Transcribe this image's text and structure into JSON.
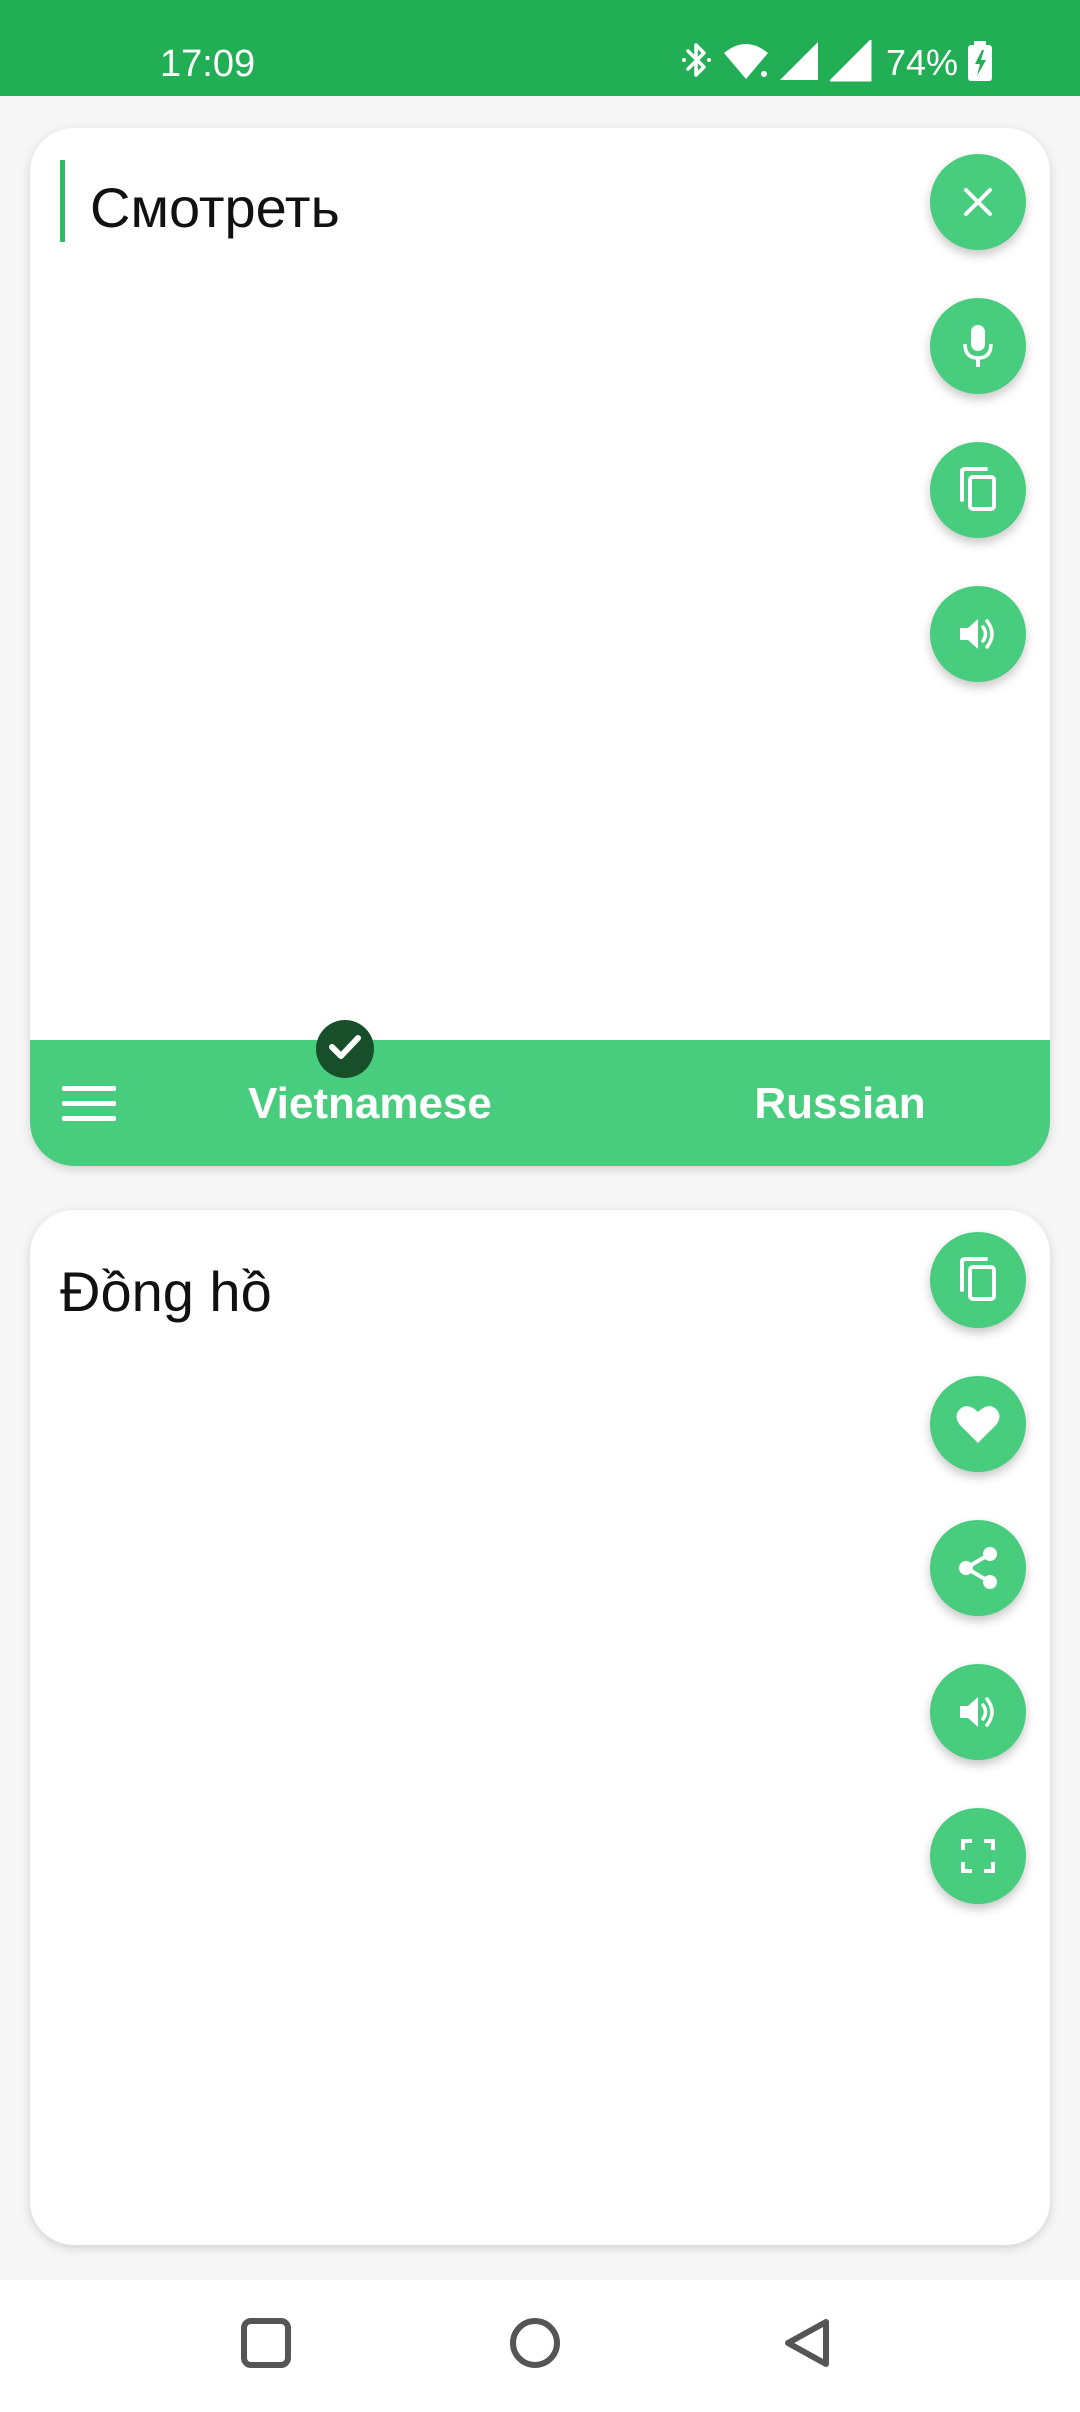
{
  "status_bar": {
    "time": "17:09",
    "battery": "74%",
    "icons": [
      "bluetooth-icon",
      "wifi-icon",
      "signal-icon",
      "signal-icon",
      "battery-charging-icon"
    ],
    "color": "#22ae55"
  },
  "source_panel": {
    "text": "Смотреть",
    "buttons": [
      "close-icon",
      "microphone-icon",
      "copy-icon",
      "speaker-icon"
    ]
  },
  "language_bar": {
    "source_language": "Vietnamese",
    "target_language": "Russian",
    "source_selected": true,
    "menu_icon": "menu-icon",
    "color": "#48cc7e"
  },
  "target_panel": {
    "text": "Đồng hồ",
    "buttons": [
      "copy-icon",
      "heart-icon",
      "share-icon",
      "speaker-icon",
      "fullscreen-icon"
    ]
  },
  "nav_bar": {
    "buttons": [
      "recents-icon",
      "home-icon",
      "back-icon"
    ]
  },
  "colors": {
    "accent": "#48cc7e",
    "status_bar": "#22ae55",
    "badge": "#174f2b"
  }
}
